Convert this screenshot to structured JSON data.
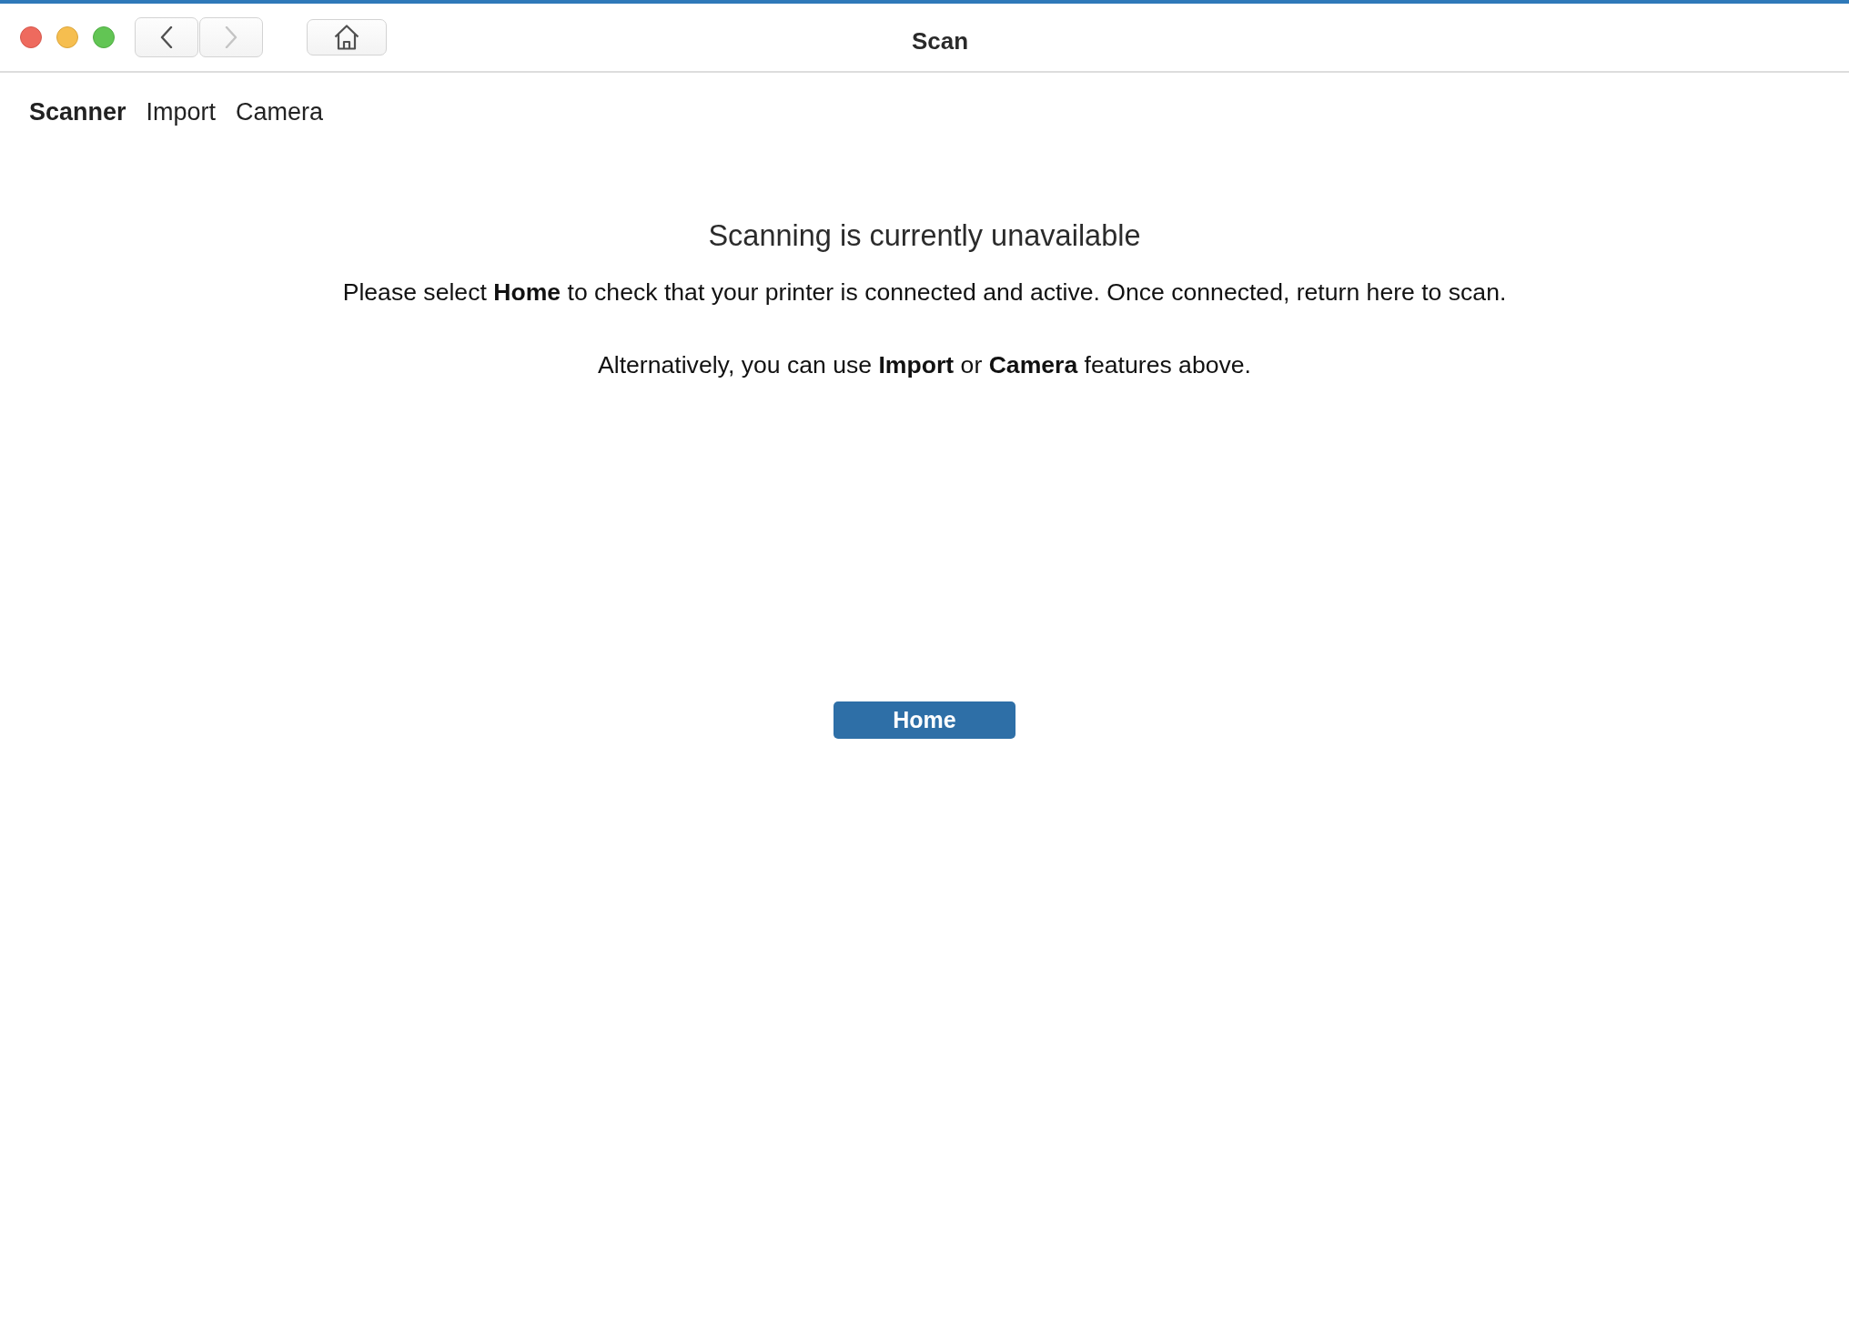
{
  "window": {
    "title": "Scan"
  },
  "nav_buttons": [
    {
      "kind": "back",
      "disabled": false
    },
    {
      "kind": "forward",
      "disabled": true
    },
    {
      "kind": "home",
      "disabled": false
    }
  ],
  "tabs": [
    {
      "label": "Scanner",
      "selected": true
    },
    {
      "label": "Import",
      "selected": false
    },
    {
      "label": "Camera",
      "selected": false
    }
  ],
  "message": {
    "title": "Scanning is currently unavailable",
    "paragraphs": [
      "Please select **Home** to check that your printer is connected and active. Once connected, return here to scan.",
      "Alternatively, you can use **Import** or **Camera** features above."
    ]
  },
  "action_button": {
    "label": "Home"
  }
}
